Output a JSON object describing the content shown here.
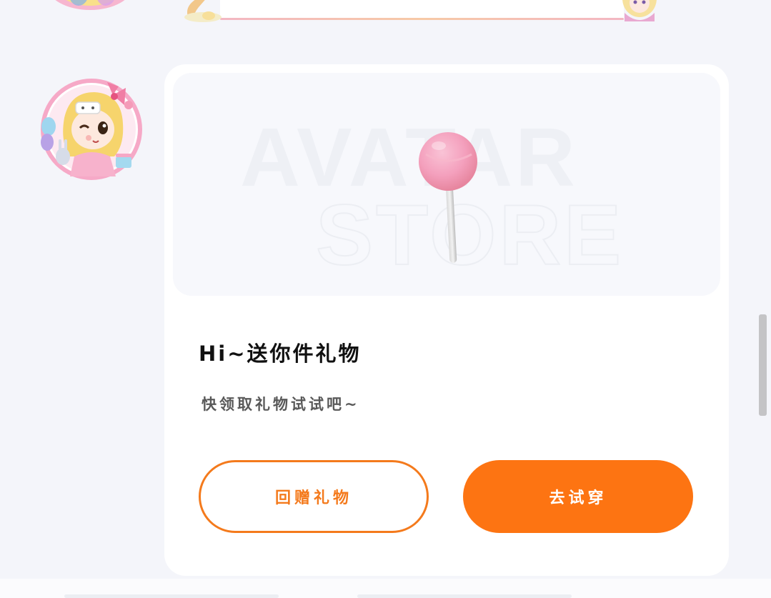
{
  "gift_card": {
    "banner": {
      "watermark_line1": "AVATAR",
      "watermark_line2": "STORE",
      "gift_icon": "lollipop-icon"
    },
    "title": "Hi~送你件礼物",
    "subtitle": "快领取礼物试试吧~",
    "return_gift_label": "回赠礼物",
    "try_on_label": "去试穿"
  },
  "colors": {
    "accent_orange": "#fd7412",
    "outline_orange": "#f47a1c",
    "page_background": "#f4f5fa",
    "card_background": "#ffffff",
    "lollipop_pink": "#f4a0bd"
  }
}
